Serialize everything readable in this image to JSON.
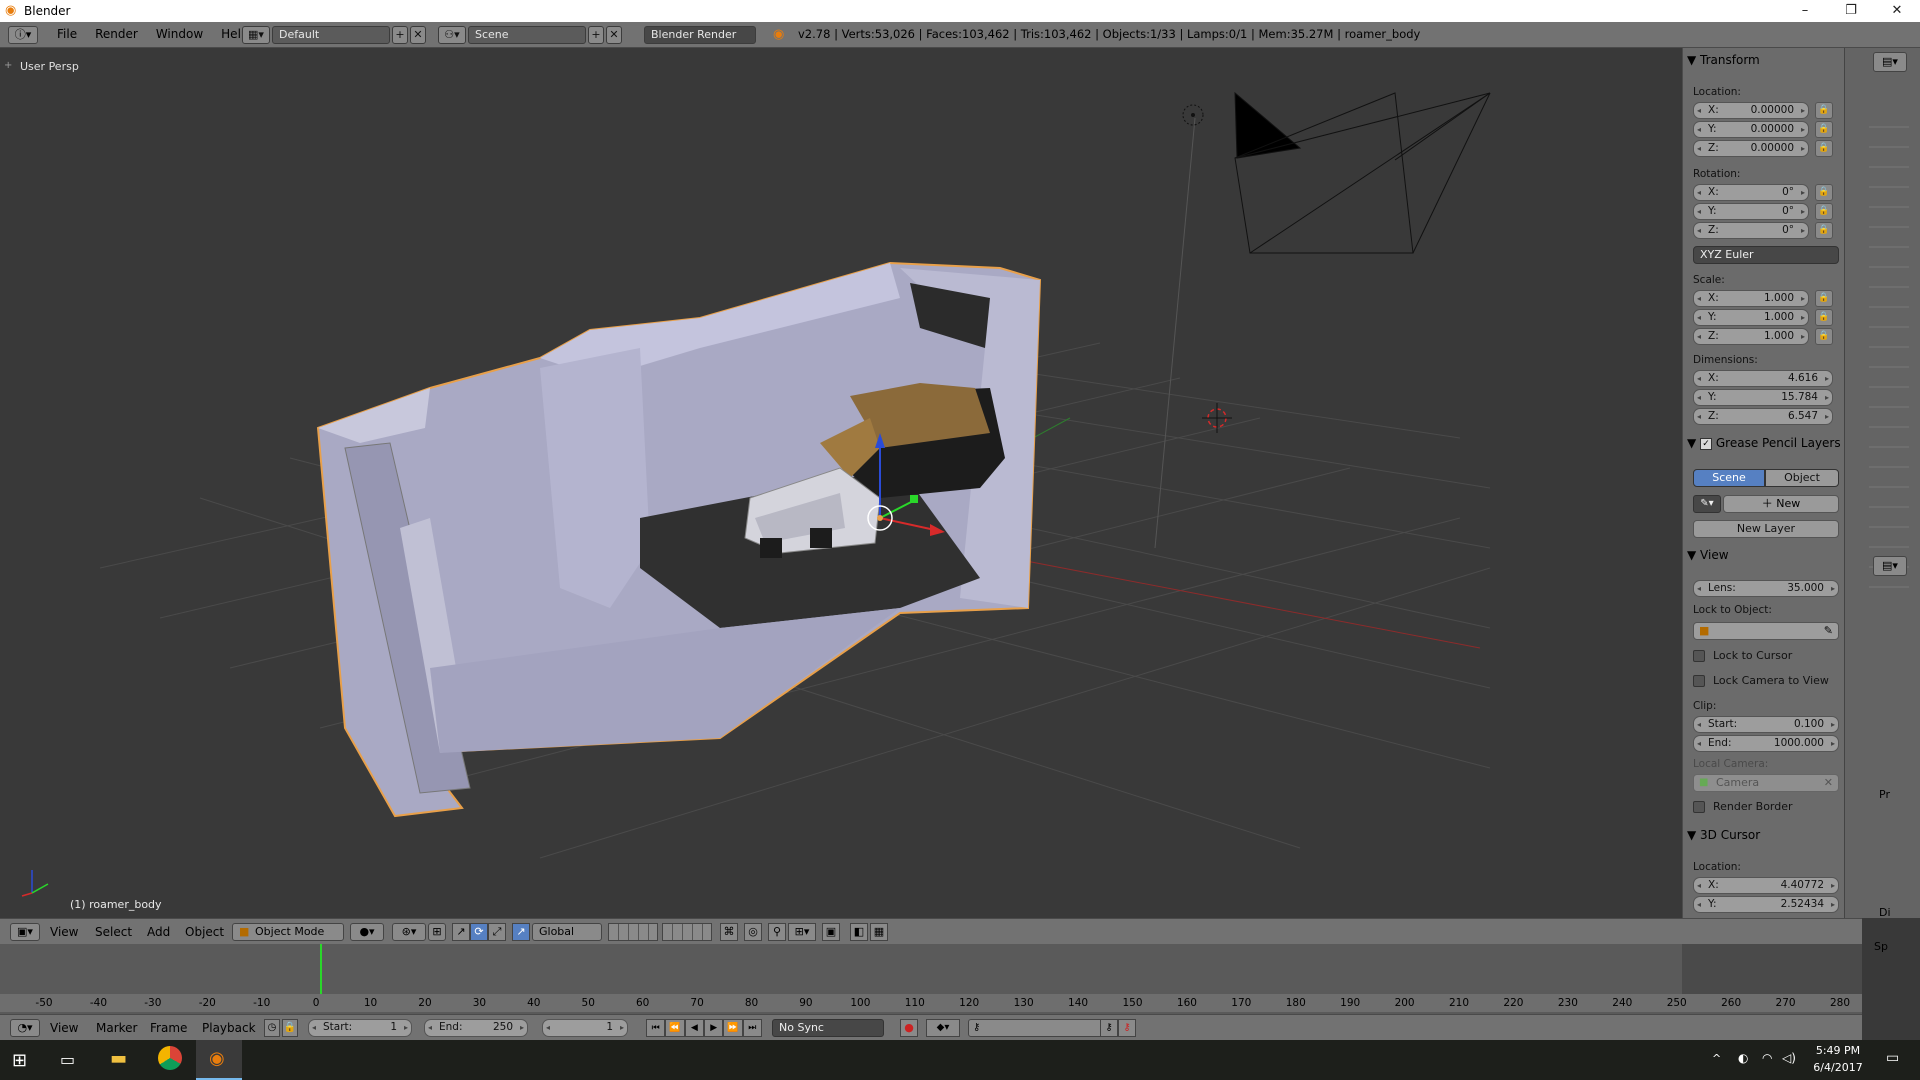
{
  "window": {
    "title": "Blender",
    "minimize": "–",
    "maximize": "❐",
    "close": "✕"
  },
  "info_header": {
    "menus": [
      "File",
      "Render",
      "Window",
      "Help"
    ],
    "screen_layout": "Default",
    "scene": "Scene",
    "render_engine": "Blender Render",
    "stats": "v2.78 | Verts:53,026 | Faces:103,462 | Tris:103,462 | Objects:1/33 | Lamps:0/1 | Mem:35.27M | roamer_body"
  },
  "viewport": {
    "view_label": "User Persp",
    "active_object_label": "(1) roamer_body"
  },
  "properties_panel": {
    "transform": {
      "header": "Transform",
      "location_label": "Location:",
      "location": [
        {
          "axis": "X:",
          "value": "0.00000"
        },
        {
          "axis": "Y:",
          "value": "0.00000"
        },
        {
          "axis": "Z:",
          "value": "0.00000"
        }
      ],
      "rotation_label": "Rotation:",
      "rotation": [
        {
          "axis": "X:",
          "value": "0°"
        },
        {
          "axis": "Y:",
          "value": "0°"
        },
        {
          "axis": "Z:",
          "value": "0°"
        }
      ],
      "rotation_mode": "XYZ Euler",
      "scale_label": "Scale:",
      "scale": [
        {
          "axis": "X:",
          "value": "1.000"
        },
        {
          "axis": "Y:",
          "value": "1.000"
        },
        {
          "axis": "Z:",
          "value": "1.000"
        }
      ],
      "dimensions_label": "Dimensions:",
      "dimensions": [
        {
          "axis": "X:",
          "value": "4.616"
        },
        {
          "axis": "Y:",
          "value": "15.784"
        },
        {
          "axis": "Z:",
          "value": "6.547"
        }
      ]
    },
    "grease_pencil": {
      "header": "Grease Pencil Layers",
      "tab_scene": "Scene",
      "tab_object": "Object",
      "new": "New",
      "new_layer": "New Layer"
    },
    "view": {
      "header": "View",
      "lens_label": "Lens:",
      "lens": "35.000",
      "lock_to_object_label": "Lock to Object:",
      "lock_to_cursor": "Lock to Cursor",
      "lock_camera_to_view": "Lock Camera to View",
      "clip_label": "Clip:",
      "clip_start_label": "Start:",
      "clip_start": "0.100",
      "clip_end_label": "End:",
      "clip_end": "1000.000",
      "local_camera_label": "Local Camera:",
      "local_camera": "Camera",
      "render_border": "Render Border"
    },
    "cursor_3d": {
      "header": "3D Cursor",
      "location_label": "Location:",
      "x_label": "X:",
      "x": "4.40772",
      "y_label": "Y:",
      "y": "2.52434"
    }
  },
  "viewport_header": {
    "menus": [
      "View",
      "Select",
      "Add",
      "Object"
    ],
    "mode": "Object Mode",
    "orientation": "Global"
  },
  "timeline": {
    "ticks": [
      "-50",
      "-40",
      "-30",
      "-20",
      "-10",
      "0",
      "10",
      "20",
      "30",
      "40",
      "50",
      "60",
      "70",
      "80",
      "90",
      "100",
      "110",
      "120",
      "130",
      "140",
      "150",
      "160",
      "170",
      "180",
      "190",
      "200",
      "210",
      "220",
      "230",
      "240",
      "250",
      "260",
      "270",
      "280"
    ],
    "menus": [
      "View",
      "Marker",
      "Frame",
      "Playback"
    ],
    "start_label": "Start:",
    "start": "1",
    "end_label": "End:",
    "end": "250",
    "current_frame": "1",
    "sync": "No Sync"
  },
  "side_panel_labels": [
    "Pr",
    "Di",
    "Sp"
  ],
  "taskbar": {
    "time": "5:49 PM",
    "date": "6/4/2017"
  },
  "colors": {
    "accent_blue": "#5680c2",
    "viewport_bg": "#393939",
    "selection_outline": "#e8a04a"
  }
}
